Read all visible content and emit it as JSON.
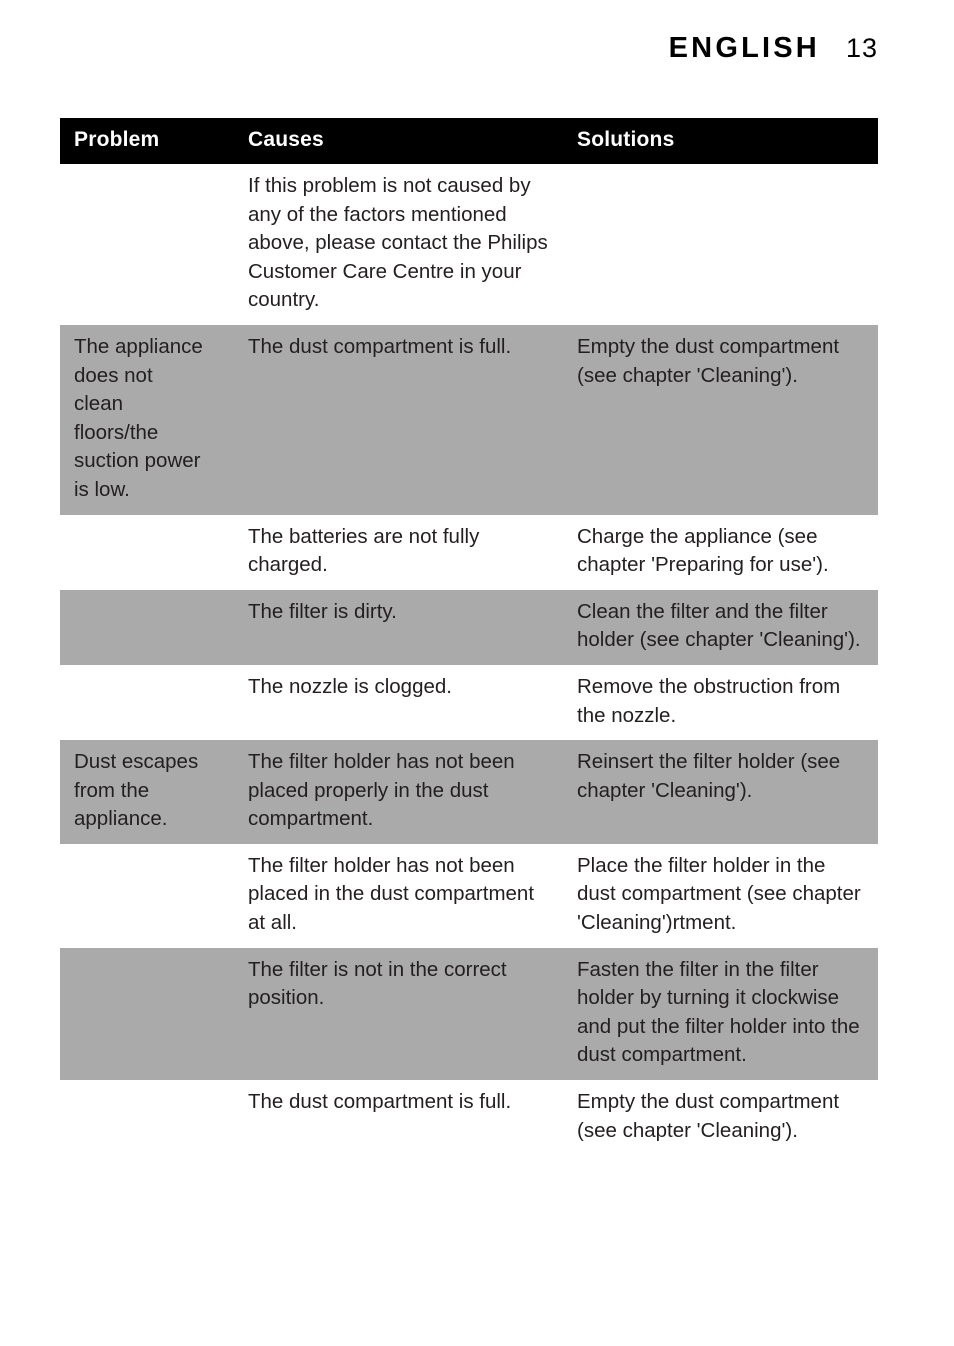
{
  "header": {
    "title": "ENGLISH",
    "page_number": "13"
  },
  "table": {
    "columns": [
      {
        "key": "problem",
        "label": "Problem"
      },
      {
        "key": "causes",
        "label": "Causes"
      },
      {
        "key": "solutions",
        "label": "Solutions"
      }
    ],
    "rows": [
      {
        "shaded": false,
        "problem": "",
        "causes": "If this problem is not caused by any of the factors mentioned above, please contact the Philips Customer Care Centre in your country.",
        "solutions": ""
      },
      {
        "shaded": true,
        "problem": "The appliance\ndoes not\nclean\nfloors/the\nsuction power\nis low.",
        "causes": "The dust compartment is full.",
        "solutions": "Empty the dust compartment (see chapter 'Cleaning')."
      },
      {
        "shaded": false,
        "problem": "",
        "causes": "The batteries are not fully charged.",
        "solutions": "Charge the appliance (see chapter 'Preparing for use')."
      },
      {
        "shaded": true,
        "problem": "",
        "causes": "The filter is dirty.",
        "solutions": "Clean the filter and the filter holder (see chapter 'Cleaning')."
      },
      {
        "shaded": false,
        "problem": "",
        "causes": "The nozzle is clogged.",
        "solutions": "Remove the obstruction from the nozzle."
      },
      {
        "shaded": true,
        "problem": "Dust escapes\nfrom the\nappliance.",
        "causes": "The filter holder has not been placed properly in the dust compartment.",
        "solutions": "Reinsert the filter holder (see chapter 'Cleaning')."
      },
      {
        "shaded": false,
        "problem": "",
        "causes": "The filter holder has not been placed in the dust compartment at all.",
        "solutions": "Place the filter holder in the dust compartment (see chapter 'Cleaning')rtment."
      },
      {
        "shaded": true,
        "problem": "",
        "causes": "The filter is not in the correct position.",
        "solutions": "Fasten the filter in the filter holder by turning it clockwise and put the filter holder into the dust compartment."
      },
      {
        "shaded": false,
        "problem": "",
        "causes": "The dust compartment is full.",
        "solutions": "Empty the dust compartment (see chapter 'Cleaning')."
      }
    ]
  },
  "colors": {
    "header_band": "#000000",
    "shaded_row": "#aaaaaa",
    "text": "#231f20",
    "page_background": "#ffffff"
  }
}
